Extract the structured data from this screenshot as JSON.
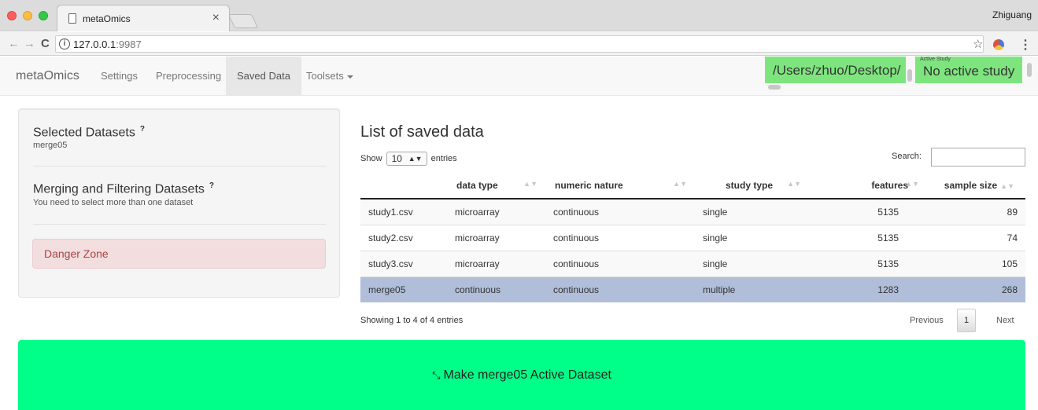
{
  "browser": {
    "tab_title": "metaOmics",
    "tab_close": "×",
    "profile_name": "Zhiguang",
    "url_host": "127.0.0.1",
    "url_port": ":9987",
    "nav_back": "←",
    "nav_forward": "→",
    "nav_reload": "C",
    "info_glyph": "i",
    "star_glyph": "☆",
    "menu_glyph": "⋮"
  },
  "navbar": {
    "brand": "metaOmics",
    "items": [
      {
        "label": "Settings"
      },
      {
        "label": "Preprocessing"
      },
      {
        "label": "Saved Data"
      },
      {
        "label": "Toolsets"
      }
    ],
    "active_item": "Saved Data",
    "working_dir": "/Users/zhuo/Desktop/",
    "active_study_label": "Active Study",
    "active_study_value": "No active study"
  },
  "sidebar": {
    "selected_heading": "Selected Datasets",
    "selected_value": "merge05",
    "merge_heading": "Merging and Filtering Datasets",
    "merge_note": "You need to select more than one dataset",
    "danger_label": "Danger Zone",
    "help_glyph": "?"
  },
  "list": {
    "title": "List of saved data",
    "show_prefix": "Show",
    "show_value": "10",
    "show_suffix": "entries",
    "search_label": "Search:",
    "search_value": "",
    "columns": [
      "",
      "data type",
      "numeric nature",
      "study type",
      "features",
      "sample size"
    ],
    "rows": [
      {
        "name": "study1.csv",
        "data_type": "microarray",
        "numeric_nature": "continuous",
        "study_type": "single",
        "features": "5135",
        "sample_size": "89"
      },
      {
        "name": "study2.csv",
        "data_type": "microarray",
        "numeric_nature": "continuous",
        "study_type": "single",
        "features": "5135",
        "sample_size": "74"
      },
      {
        "name": "study3.csv",
        "data_type": "microarray",
        "numeric_nature": "continuous",
        "study_type": "single",
        "features": "5135",
        "sample_size": "105"
      },
      {
        "name": "merge05",
        "data_type": "continuous",
        "numeric_nature": "continuous",
        "study_type": "multiple",
        "features": "1283",
        "sample_size": "268"
      }
    ],
    "selected_row": "merge05",
    "info": "Showing 1 to 4 of 4 entries",
    "prev_label": "Previous",
    "page": "1",
    "next_label": "Next"
  },
  "action_button": {
    "label": "Make merge05 Active Dataset",
    "icon": "compress-icon",
    "color": "#00ff88"
  },
  "colors": {
    "path_box": "#7ee57e",
    "danger_bg": "#f2dede",
    "danger_text": "#a94442",
    "selected_row": "#b0bed9"
  }
}
